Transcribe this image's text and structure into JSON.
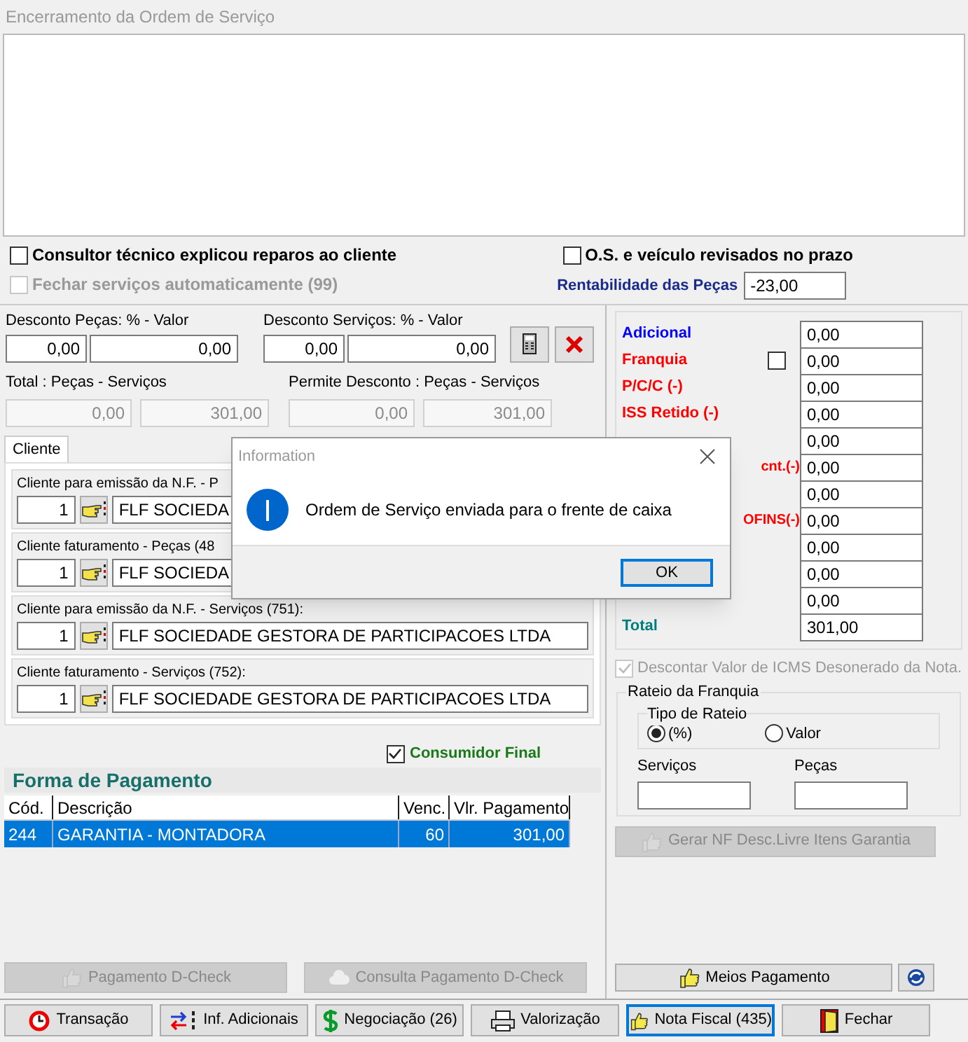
{
  "window": {
    "title": "Encerramento da Ordem de Serviço"
  },
  "options": [
    {
      "label": "Consultor técnico explicou reparos ao cliente",
      "checked": false,
      "disabled": false
    },
    {
      "label": "Fechar serviços automaticamente (99)",
      "checked": false,
      "disabled": true
    }
  ],
  "review": {
    "label": "O.S. e veículo revisados no prazo",
    "checked": false
  },
  "rentabilidade": {
    "label": "Rentabilidade das Peças",
    "value": "-23,00"
  },
  "discounts": [
    {
      "label": "Desconto Peças: % - Valor",
      "percent": "0,00",
      "value": "0,00"
    },
    {
      "label": "Desconto Serviços: % - Valor",
      "percent": "0,00",
      "value": "0,00"
    }
  ],
  "totals": [
    {
      "label": "Total : Peças - Serviços",
      "values": [
        "0,00",
        "301,00"
      ]
    },
    {
      "label": "Permite Desconto : Peças - Serviços",
      "values": [
        "0,00",
        "301,00"
      ]
    }
  ],
  "tabs": [
    {
      "label": "Cliente",
      "selected": true
    }
  ],
  "clients": [
    {
      "label": "Cliente para emissão da N.F. - P",
      "code": "1",
      "name": "FLF SOCIEDA"
    },
    {
      "label": "Cliente faturamento - Peças (48",
      "code": "1",
      "name": "FLF SOCIEDA"
    },
    {
      "label": "Cliente para emissão da N.F. - Serviços (751):",
      "code": "1",
      "name": "FLF SOCIEDADE GESTORA DE PARTICIPACOES LTDA"
    },
    {
      "label": "Cliente faturamento - Serviços (752):",
      "code": "1",
      "name": "FLF SOCIEDADE GESTORA DE PARTICIPACOES LTDA"
    }
  ],
  "consumidor_final": {
    "label": "Consumidor Final",
    "checked": true
  },
  "payment": {
    "title": "Forma de Pagamento",
    "columns": [
      "Cód.",
      "Descrição",
      "Venc.",
      "Vlr. Pagamento"
    ],
    "rows": [
      {
        "cells": [
          "244",
          "GARANTIA - MONTADORA",
          "60",
          "301,00"
        ],
        "selected": true
      }
    ]
  },
  "dcheck_buttons": [
    {
      "label": "Pagamento D-Check",
      "disabled": true
    },
    {
      "label": "Consulta Pagamento D-Check",
      "disabled": true
    }
  ],
  "values": [
    {
      "label": "Adicional",
      "color": "#0000ff",
      "value": "0,00",
      "kind": "plain"
    },
    {
      "label": "Franquia",
      "color": "#ff0000",
      "value": "0,00",
      "kind": "checkbox",
      "checked": false
    },
    {
      "label": "P/C/C (-)",
      "color": "#ff0000",
      "value": "0,00",
      "kind": "plain"
    },
    {
      "label": "ISS Retido (-)",
      "color": "#ff0000",
      "value": "0,00",
      "kind": "plain"
    },
    {
      "value": "0,00",
      "kind": "hidden"
    },
    {
      "label": "cnt.(-)",
      "color": "#ff0000",
      "value": "0,00",
      "kind": "fragment"
    },
    {
      "value": "0,00",
      "kind": "hidden"
    },
    {
      "label": "OFINS(-)",
      "color": "#ff0000",
      "value": "0,00",
      "kind": "fragment"
    },
    {
      "value": "0,00",
      "kind": "hidden"
    },
    {
      "value": "0,00",
      "kind": "hidden"
    },
    {
      "value": "0,00",
      "kind": "hidden"
    },
    {
      "label": "Total",
      "color": "#008080",
      "value": "301,00",
      "kind": "plain"
    }
  ],
  "icms": {
    "label": "Descontar Valor de ICMS Desonerado da Nota.",
    "checked": true,
    "disabled": true
  },
  "rateio": {
    "title": "Rateio da Franquia",
    "tipo_title": "Tipo de Rateio",
    "options": [
      {
        "label": "(%)",
        "selected": true
      },
      {
        "label": "Valor",
        "selected": false
      }
    ],
    "fields": [
      {
        "label": "Serviços"
      },
      {
        "label": "Peças"
      }
    ]
  },
  "gerar_button": {
    "label": "Gerar NF Desc.Livre Itens Garantia",
    "disabled": true
  },
  "meios_button": {
    "label": "Meios Pagamento"
  },
  "toolbar": [
    {
      "label": "Transação",
      "selected": false
    },
    {
      "label": "Inf. Adicionais",
      "selected": false
    },
    {
      "label": "Negociação (26)",
      "selected": false
    },
    {
      "label": "Valorização",
      "selected": false
    },
    {
      "label": "Nota Fiscal (435)",
      "selected": true
    },
    {
      "label": "Fechar",
      "selected": false
    }
  ],
  "dialog": {
    "title": "Information",
    "message": "Ordem de Serviço enviada para o frente de caixa",
    "button": "OK"
  }
}
